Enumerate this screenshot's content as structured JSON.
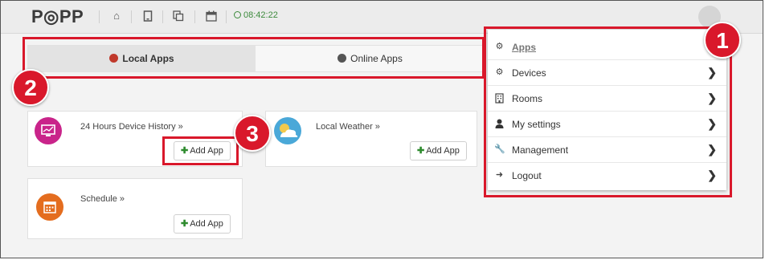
{
  "header": {
    "logo": "P◎PP",
    "time": "08:42:22",
    "icons": [
      "home-icon",
      "tablet-icon",
      "copy-icon",
      "calendar-icon"
    ]
  },
  "tabs": [
    {
      "label": "Local Apps",
      "icon": "cloud-download-icon",
      "active": true
    },
    {
      "label": "Online Apps",
      "icon": "globe-icon",
      "active": false
    }
  ],
  "cards": [
    {
      "title": "24 Hours Device History »",
      "button": "Add App",
      "icon": "monitor-icon",
      "color": "#c9248a"
    },
    {
      "title": "Local Weather »",
      "button": "Add App",
      "icon": "weather-icon",
      "color": "#4aa8d8"
    },
    {
      "title": "Schedule »",
      "button": "Add App",
      "icon": "calendar-icon",
      "color": "#e46d1f"
    }
  ],
  "menu": [
    {
      "label": "Apps",
      "icon": "apps-icon"
    },
    {
      "label": "Devices",
      "icon": "cogs-icon"
    },
    {
      "label": "Rooms",
      "icon": "building-icon"
    },
    {
      "label": "My settings",
      "icon": "user-icon"
    },
    {
      "label": "Management",
      "icon": "wrench-icon"
    },
    {
      "label": "Logout",
      "icon": "logout-icon"
    }
  ],
  "annotations": [
    "1",
    "2",
    "3"
  ],
  "colors": {
    "accent_red": "#d9182b",
    "green": "#2e8b2e"
  }
}
